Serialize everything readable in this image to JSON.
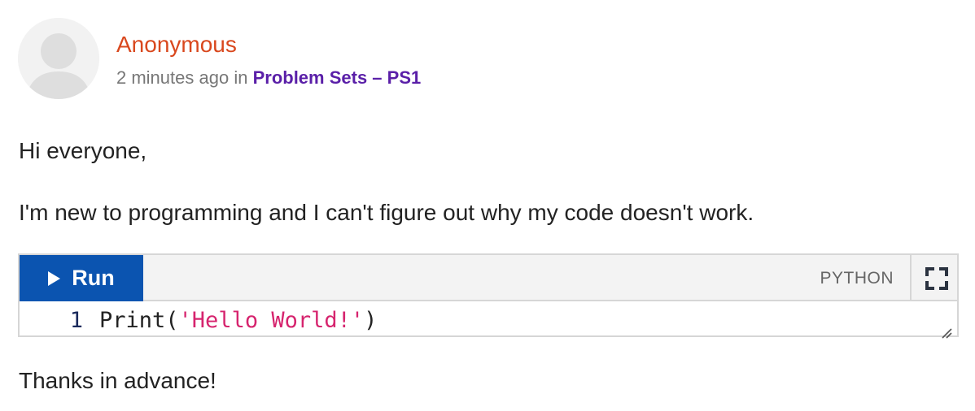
{
  "post": {
    "author": "Anonymous",
    "time_ago": "2 minutes ago",
    "in_word": "in",
    "location": "Problem Sets – PS1",
    "greeting": "Hi everyone,",
    "question": "I'm new to programming and I can't figure out why my code doesn't work.",
    "closing": "Thanks in advance!"
  },
  "code_widget": {
    "run_label": "Run",
    "language": "PYTHON",
    "lines": [
      {
        "number": "1",
        "function": "Print",
        "open_paren": "(",
        "string": "'Hello World!'",
        "close_paren": ")"
      }
    ]
  },
  "icons": {
    "avatar": "user-silhouette-icon",
    "run": "play-icon",
    "fullscreen": "fullscreen-icon",
    "resize": "resize-handle-icon"
  },
  "colors": {
    "author": "#d9481e",
    "location_link": "#5a1fa8",
    "run_button": "#0b54b0",
    "code_string": "#d6246e",
    "line_number": "#1a2a5c"
  }
}
